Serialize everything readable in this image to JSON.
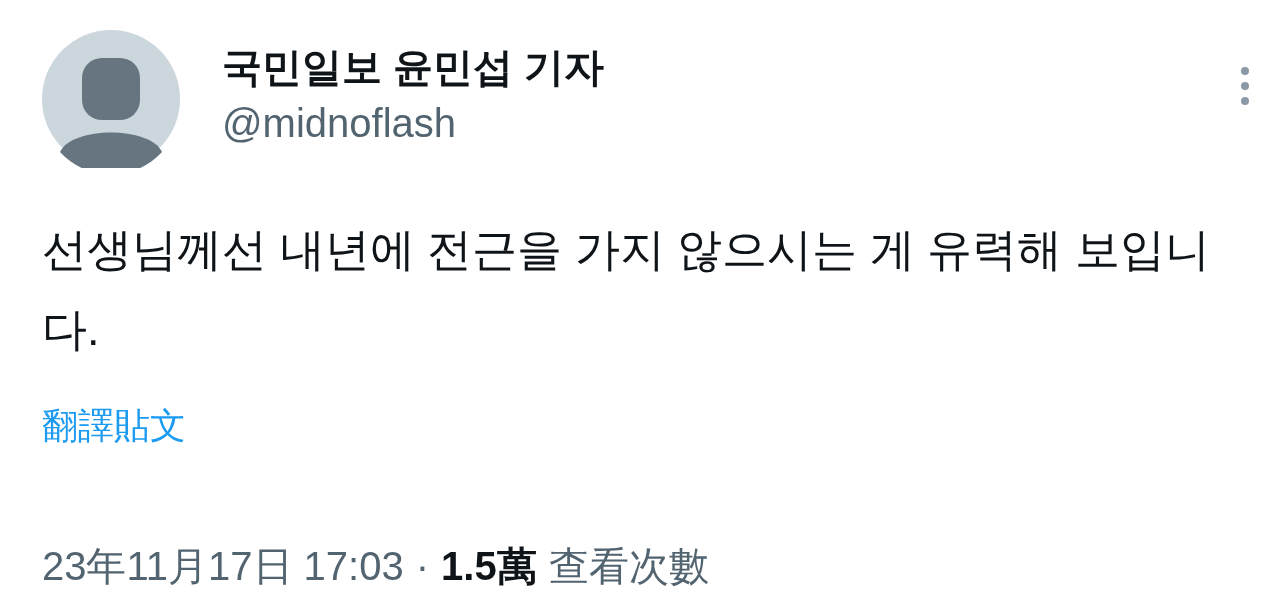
{
  "author": {
    "name": "국민일보 윤민섭 기자",
    "handle": "@midnoflash"
  },
  "body": "선생님께선 내년에 전근을 가지 않으시는 게 유력해 보입니다.",
  "translate_link": "翻譯貼文",
  "meta": {
    "timestamp": "23年11月17日 17:03",
    "separator": "·",
    "views_count": "1.5萬",
    "views_label": "查看次數"
  }
}
